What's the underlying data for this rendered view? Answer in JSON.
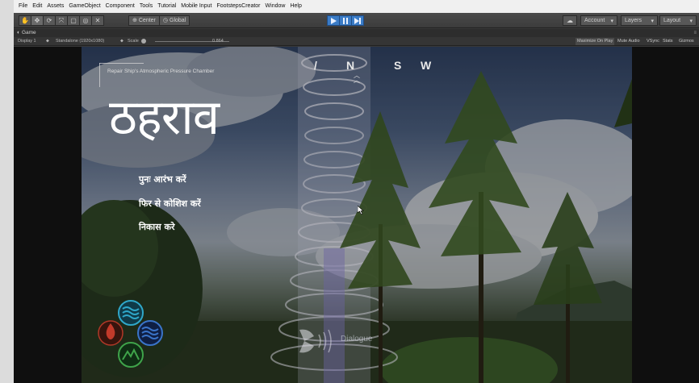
{
  "menubar": {
    "items": [
      "File",
      "Edit",
      "Assets",
      "GameObject",
      "Component",
      "Tools",
      "Tutorial",
      "Mobile Input",
      "FootstepsCreator",
      "Window",
      "Help"
    ]
  },
  "toolbar": {
    "pivot_label": "Center",
    "rotation_label": "Global",
    "account_label": "Account",
    "layers_label": "Layers",
    "layout_label": "Layout"
  },
  "game_tab": {
    "title": "Game"
  },
  "game_view": {
    "display_label": "Display 1",
    "resolution_label": "Standalone (1920x1080)",
    "scale_label": "Scale",
    "scale_value": "0.864",
    "toggles": [
      "Maximize On Play",
      "Mute Audio",
      "VSync",
      "Stats",
      "Gizmos"
    ]
  },
  "hud": {
    "location": "Repair Ship's Atmospheric Pressure Chamber",
    "compass": [
      "/",
      "N",
      "S",
      "W"
    ],
    "dialogue": "Dialogue"
  },
  "pause_menu": {
    "title": "ठहराव",
    "options": [
      "पुनः आरंभ करें",
      "फिर से कोशिश करें",
      "निकास करे"
    ]
  },
  "colors": {
    "play_blue": "#3b7cc7",
    "element_water": "#2fa7c9",
    "element_fire": "#c23a2a",
    "element_wind": "#3a74c9",
    "element_earth": "#3fa34a"
  }
}
